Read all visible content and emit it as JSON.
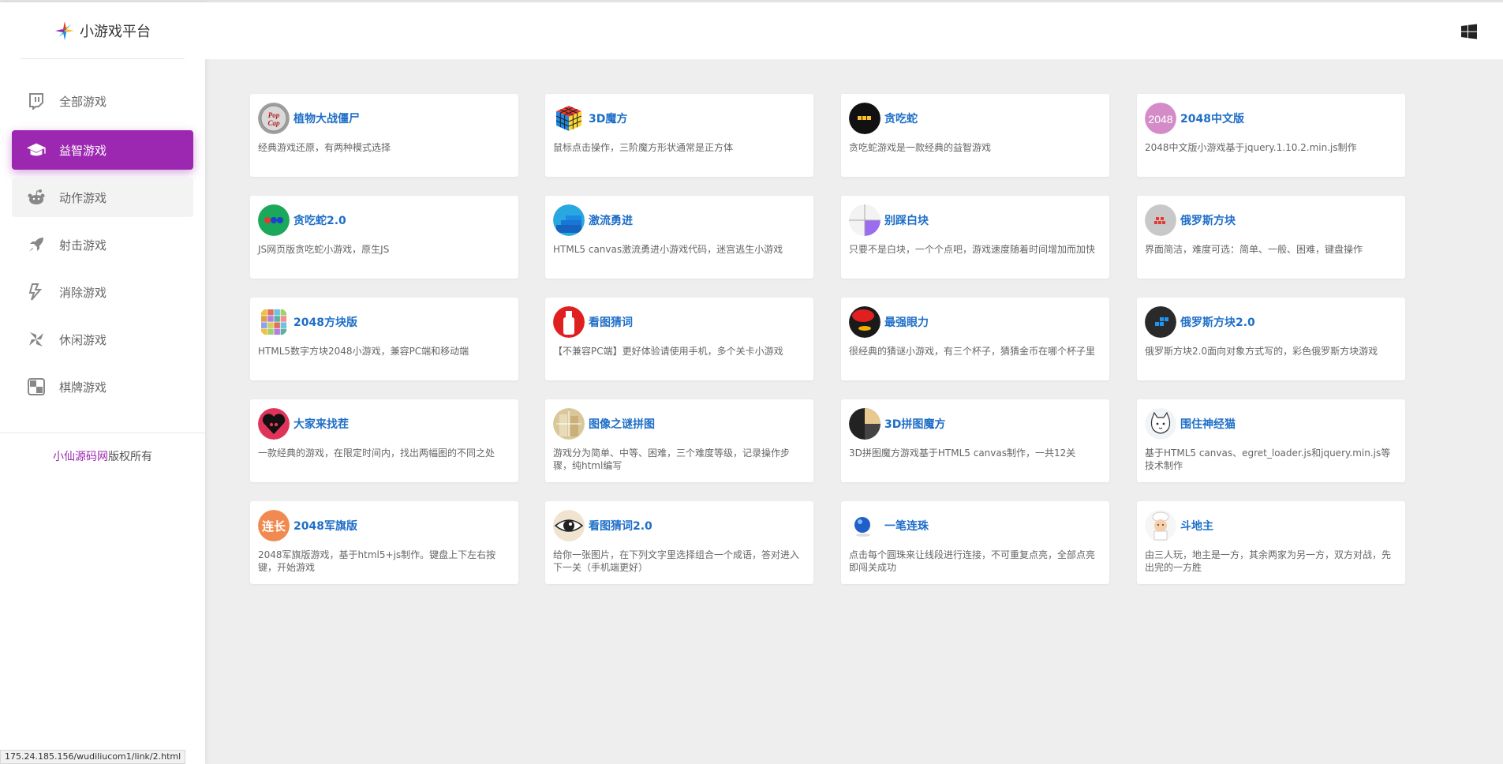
{
  "brand": {
    "title": "小游戏平台"
  },
  "nav": [
    {
      "label": "全部游戏",
      "icon": "twitch-icon"
    },
    {
      "label": "益智游戏",
      "icon": "graduation-cap-icon",
      "active": true
    },
    {
      "label": "动作游戏",
      "icon": "reddit-icon"
    },
    {
      "label": "射击游戏",
      "icon": "rocket-icon"
    },
    {
      "label": "消除游戏",
      "icon": "bolt-icon"
    },
    {
      "label": "休闲游戏",
      "icon": "pinwheel-icon"
    },
    {
      "label": "棋牌游戏",
      "icon": "checkerboard-icon"
    }
  ],
  "copyright": {
    "site": "小仙源码网",
    "suffix": "版权所有"
  },
  "header": {
    "icon": "windows-icon"
  },
  "games": [
    {
      "title": "植物大战僵尸",
      "desc": "经典游戏还原，有两种模式选择",
      "thumb": "popcap"
    },
    {
      "title": "3D魔方",
      "desc": "鼠标点击操作，三阶魔方形状通常是正方体",
      "thumb": "cube"
    },
    {
      "title": "贪吃蛇",
      "desc": "贪吃蛇游戏是一款经典的益智游戏",
      "thumb": "snake"
    },
    {
      "title": "2048中文版",
      "desc": "2048中文版小游戏基于jquery.1.10.2.min.js制作",
      "thumb": "2048"
    },
    {
      "title": "贪吃蛇2.0",
      "desc": "JS网页版贪吃蛇小游戏，原生JS",
      "thumb": "snake2"
    },
    {
      "title": "激流勇进",
      "desc": "HTML5 canvas激流勇进小游戏代码，迷宫逃生小游戏",
      "thumb": "stairs"
    },
    {
      "title": "别踩白块",
      "desc": "只要不是白块，一个个点吧，游戏速度随着时间增加而加快",
      "thumb": "tiles"
    },
    {
      "title": "俄罗斯方块",
      "desc": "界面简洁，难度可选：简单、一般、困难，键盘操作",
      "thumb": "tetris"
    },
    {
      "title": "2048方块版",
      "desc": "HTML5数字方块2048小游戏，兼容PC端和移动端",
      "thumb": "grid"
    },
    {
      "title": "看图猜词",
      "desc": "【不兼容PC端】更好体验请使用手机，多个关卡小游戏",
      "thumb": "bottle"
    },
    {
      "title": "最强眼力",
      "desc": "很经典的猜谜小游戏，有三个杯子，猜猜金币在哪个杯子里",
      "thumb": "cup"
    },
    {
      "title": "俄罗斯方块2.0",
      "desc": "俄罗斯方块2.0面向对象方式写的，彩色俄罗斯方块游戏",
      "thumb": "tetris2"
    },
    {
      "title": "大家来找茬",
      "desc": "一款经典的游戏，在限定时间内，找出两幅图的不同之处",
      "thumb": "heart"
    },
    {
      "title": "图像之谜拼图",
      "desc": "游戏分为简单、中等、困难，三个难度等级，记录操作步骤，纯html编写",
      "thumb": "puzzle"
    },
    {
      "title": "3D拼图魔方",
      "desc": "3D拼图魔方游戏基于HTML5 canvas制作，一共12关",
      "thumb": "pie"
    },
    {
      "title": "围住神经猫",
      "desc": "基于HTML5 canvas、egret_loader.js和jquery.min.js等技术制作",
      "thumb": "cat"
    },
    {
      "title": "2048军旗版",
      "desc": "2048军旗版游戏，基于html5+js制作。键盘上下左右按键，开始游戏",
      "thumb": "flag",
      "thumb_text": "连长"
    },
    {
      "title": "看图猜词2.0",
      "desc": "给你一张图片，在下列文字里选择组合一个成语，答对进入下一关（手机端更好）",
      "thumb": "eye"
    },
    {
      "title": "一笔连珠",
      "desc": "点击每个圆珠来让线段进行连接，不可重复点亮，全部点亮即闯关成功",
      "thumb": "ball"
    },
    {
      "title": "斗地主",
      "desc": "由三人玩，地主是一方，其余两家为另一方，双方对战，先出完的一方胜",
      "thumb": "chef"
    }
  ],
  "thumb_labels": {
    "popcap": "Pop Cap",
    "2048": "2048"
  },
  "statusbar": {
    "url": "175.24.185.156/wudiliucom1/link/2.html"
  }
}
